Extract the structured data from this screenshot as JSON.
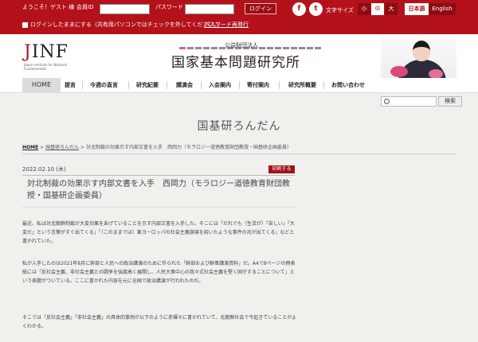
{
  "topbar": {
    "welcome": "ようこそ！ゲスト 様",
    "member_id_label": "会員ID",
    "password_label": "パスワード",
    "login_button": "ログイン",
    "font_size_label": "文字サイズ",
    "font_sizes": [
      "小",
      "中",
      "大"
    ],
    "font_size_selected": "中",
    "lang_japanese": "日本語",
    "lang_english": "English",
    "remember_label": "ログインしたままにする（共有用パソコンではチェックを外してください。）",
    "password_link": "パスワード再発行",
    "social": [
      {
        "name": "facebook-icon",
        "glyph": "f"
      },
      {
        "name": "twitter-icon",
        "glyph": "t"
      }
    ]
  },
  "header": {
    "logo_text": "INF",
    "logo_j": "J",
    "logo_sub": "Japan Institute for National Fundamentals",
    "org_small": "公益財団法人",
    "org_name": "国家基本問題研究所"
  },
  "nav": {
    "items": [
      "HOME",
      "提言",
      "今週の直言",
      "研究紀要",
      "講演会",
      "入会案内",
      "寄付案内",
      "研究所概要",
      "お問い合わせ"
    ]
  },
  "search": {
    "placeholder": "",
    "button": "検索"
  },
  "section_title": "国基研ろんだん",
  "breadcrumb": {
    "home": "HOME",
    "sep": ">",
    "category": "国基研ろんだん",
    "current": "対北制裁の効果示す内部文書を入手　西岡力（モラロジー道徳教育財団教授・国基研企画委員）"
  },
  "article": {
    "date": "2022.02.10 (木)",
    "print_button": "印刷する",
    "title": "対北制裁の効果示す内部文書を入手　西岡力（モラロジー道徳教育財団教授・国基研企画委員）",
    "paragraphs": [
      "最近、私は対北朝鮮制裁が大変効果をあげていることを示す内部文書を入手した。そこには「だれでも（生活が）『苦しい』『大変だ』という言葉がすぐ出てくる」「（このままでは）東ヨーロッパの社会主義崩壊を招いたような事件の兆が出てくる」などと書かれていた。",
      "私が入手したのは2021年8月に幹部と人民への政治講演のために作られた「幹部および群衆講演資料」だ。A4で8ページの冊表紙には「反社会主義、非社会主義との闘争を強度高く展開し、人民大衆中心の我々式社会主義を堅く固守することについて」という表題がついている。ここに書かれた内容を元に全国で政治講演が行われたのだ。",
      "そこでは「反社会主義」「非社会主義」の具体的事例が以下のように赤裸々に書かれていて、北朝鮮社会で今起きていることがよくわかる。"
    ]
  }
}
